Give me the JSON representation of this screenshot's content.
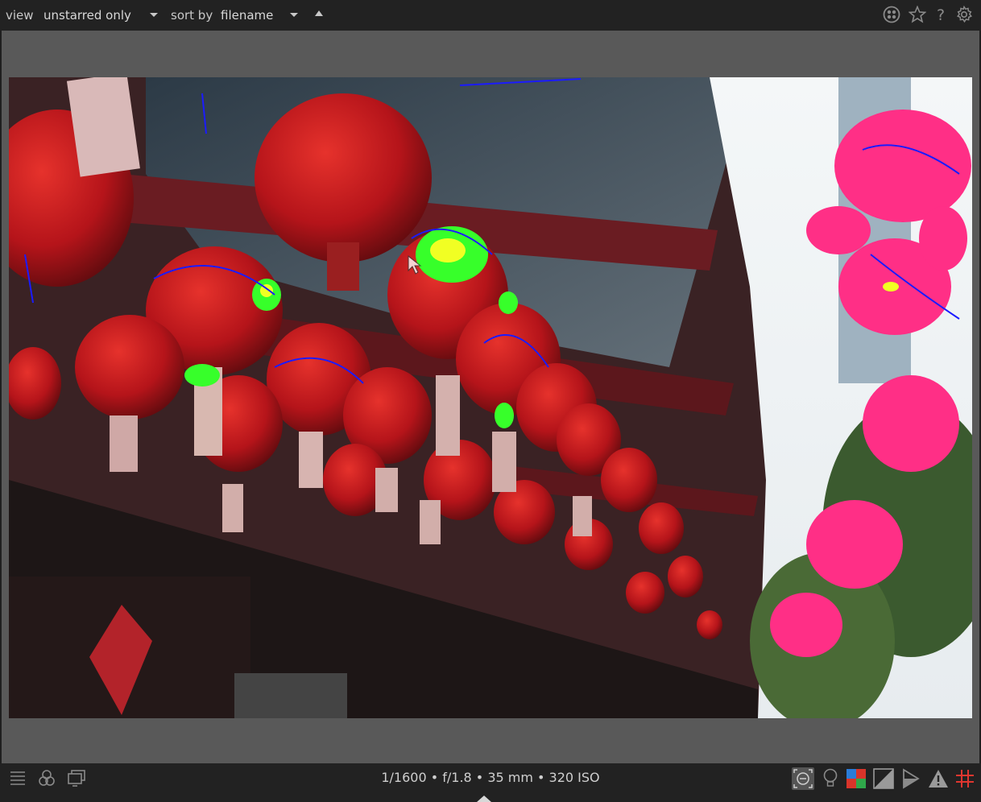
{
  "toolbar": {
    "view_label": "view",
    "view_value": "unstarred only",
    "sort_label": "sort by",
    "sort_value": "filename",
    "icons": [
      "color-labels-icon",
      "star-icon",
      "help-icon",
      "gear-icon"
    ]
  },
  "status": {
    "exif": "1/1600 • f/1.8 • 35 mm • 320 ISO"
  },
  "bottom_icons_left": [
    "menu-icon",
    "styles-icon",
    "display-icon"
  ],
  "bottom_icons_right": [
    "focus-peaking-icon",
    "lightbulb-icon",
    "color-assessment-icon",
    "overexposed-icon",
    "softproof-icon",
    "gamut-warning-icon",
    "guides-icon"
  ],
  "colors": {
    "accent_red": "#e0362f",
    "lantern_red": "#c4161c",
    "blossom_pink": "#ff2f86",
    "peaking_green": "#37ff2a",
    "peaking_yellow": "#f1ff23",
    "peaking_blue": "#1b1bff"
  }
}
